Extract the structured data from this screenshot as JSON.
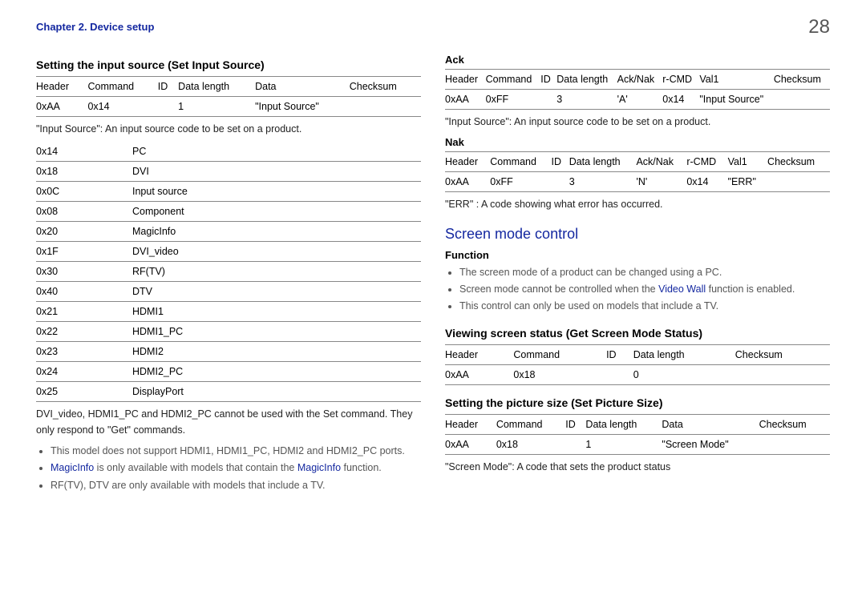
{
  "pageNumber": "28",
  "chapter": "Chapter 2. Device setup",
  "left": {
    "heading": "Setting the input source (Set Input Source)",
    "tableA": {
      "headers": [
        "Header",
        "Command",
        "ID",
        "Data length",
        "Data",
        "Checksum"
      ],
      "row": [
        "0xAA",
        "0x14",
        "",
        "1",
        "\"Input Source\"",
        ""
      ]
    },
    "noteA": "\"Input Source\": An input source code to be set on a product.",
    "codes": [
      [
        "0x14",
        "PC"
      ],
      [
        "0x18",
        "DVI"
      ],
      [
        "0x0C",
        "Input source"
      ],
      [
        "0x08",
        "Component"
      ],
      [
        "0x20",
        "MagicInfo"
      ],
      [
        "0x1F",
        "DVI_video"
      ],
      [
        "0x30",
        "RF(TV)"
      ],
      [
        "0x40",
        "DTV"
      ],
      [
        "0x21",
        "HDMI1"
      ],
      [
        "0x22",
        "HDMI1_PC"
      ],
      [
        "0x23",
        "HDMI2"
      ],
      [
        "0x24",
        "HDMI2_PC"
      ],
      [
        "0x25",
        "DisplayPort"
      ]
    ],
    "noteB": "DVI_video, HDMI1_PC and HDMI2_PC cannot be used with the Set command. They only respond to \"Get\" commands.",
    "bul1_a": "This model does not support HDMI1, HDMI1_PC, HDMI2 and HDMI2_PC ports.",
    "bul2_a": "MagicInfo",
    "bul2_b": " is only available with models that contain the ",
    "bul2_c": "MagicInfo",
    "bul2_d": " function.",
    "bul3": "RF(TV), DTV are only available with models that include a TV."
  },
  "right": {
    "ack": "Ack",
    "ackHeaders": [
      "Header",
      "Command",
      "ID",
      "Data length",
      "Ack/Nak",
      "r-CMD",
      "Val1",
      "Checksum"
    ],
    "ackRow": [
      "0xAA",
      "0xFF",
      "",
      "3",
      "'A'",
      "0x14",
      "\"Input Source\"",
      ""
    ],
    "ackNote": "\"Input Source\": An input source code to be set on a product.",
    "nak": "Nak",
    "nakHeaders": [
      "Header",
      "Command",
      "ID",
      "Data length",
      "Ack/Nak",
      "r-CMD",
      "Val1",
      "Checksum"
    ],
    "nakRow": [
      "0xAA",
      "0xFF",
      "",
      "3",
      "'N'",
      "0x14",
      "\"ERR\"",
      ""
    ],
    "nakNote": "\"ERR\" : A code showing what error has occurred.",
    "section2": "Screen mode control",
    "func": "Function",
    "funcBul1": "The screen mode of a product can be changed using a PC.",
    "funcBul2_a": "Screen mode cannot be controlled when the ",
    "funcBul2_b": "Video Wall",
    "funcBul2_c": " function is enabled.",
    "funcBul3": "This control can only be used on models that include a TV.",
    "viewHeading": "Viewing screen status (Get Screen Mode Status)",
    "viewHeaders": [
      "Header",
      "Command",
      "ID",
      "Data length",
      "Checksum"
    ],
    "viewRow": [
      "0xAA",
      "0x18",
      "",
      "0",
      ""
    ],
    "setHeading": "Setting the picture size (Set Picture Size)",
    "setHeaders": [
      "Header",
      "Command",
      "ID",
      "Data length",
      "Data",
      "Checksum"
    ],
    "setRow": [
      "0xAA",
      "0x18",
      "",
      "1",
      "\"Screen Mode\"",
      ""
    ],
    "setNote": "\"Screen Mode\": A code that sets the product status"
  }
}
